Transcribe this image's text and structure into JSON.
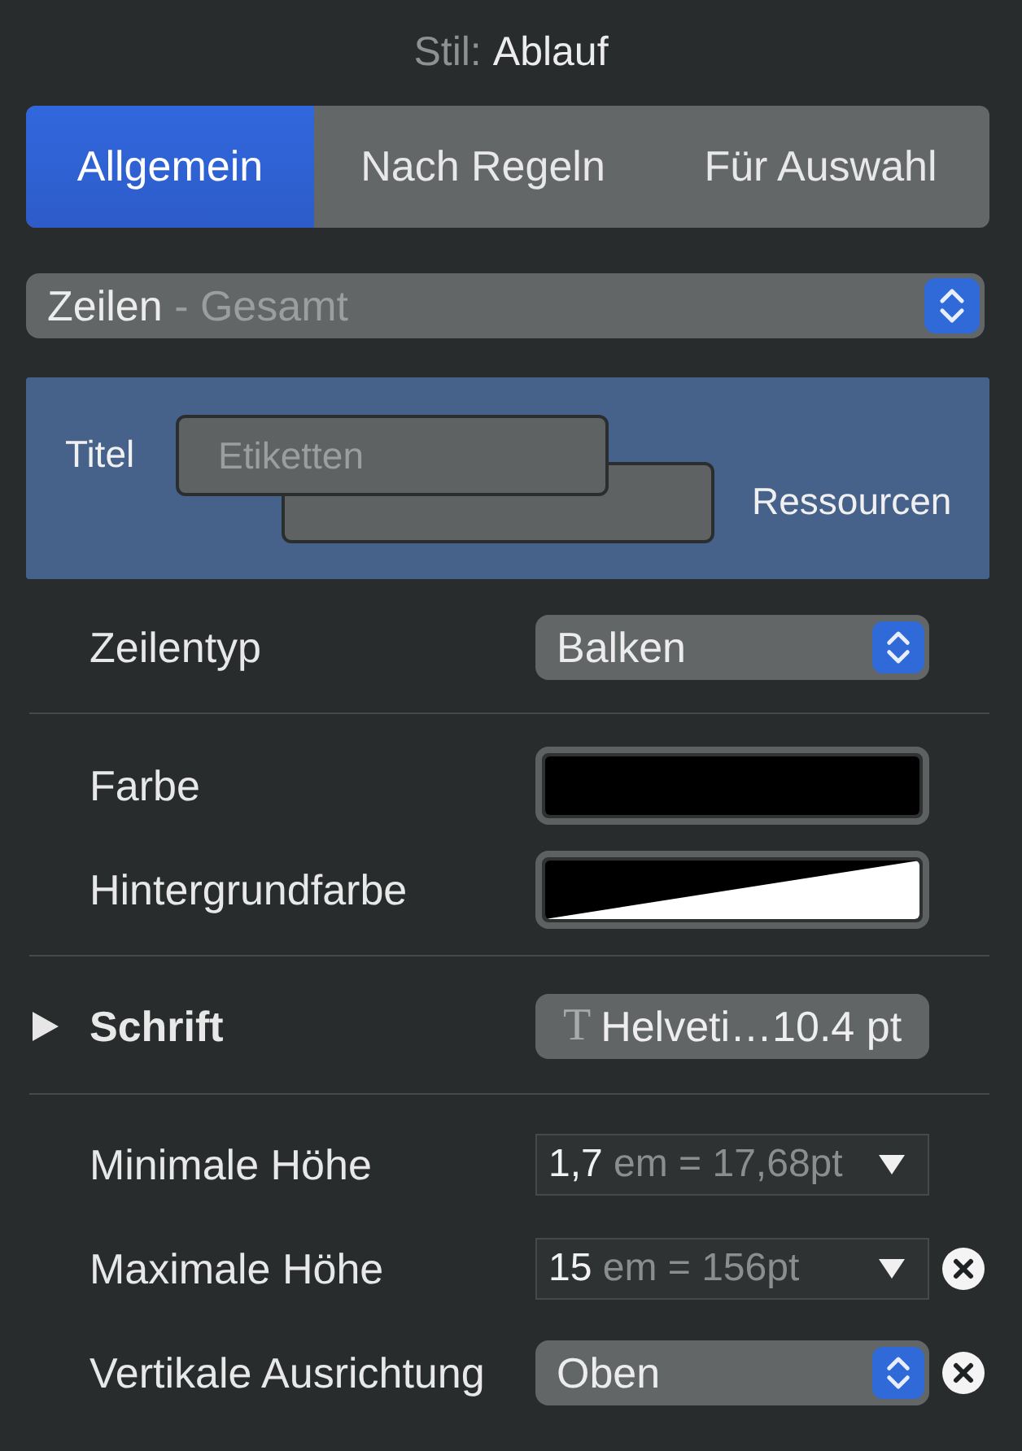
{
  "title": {
    "label": "Stil:",
    "value": "Ablauf"
  },
  "tabs": [
    {
      "label": "Allgemein",
      "selected": true
    },
    {
      "label": "Nach Regeln",
      "selected": false
    },
    {
      "label": "Für Auswahl",
      "selected": false
    }
  ],
  "scope_popup": {
    "value": "Zeilen",
    "detail": "- Gesamt"
  },
  "preview": {
    "title_label": "Titel",
    "bar_label": "Etiketten",
    "resource_label": "Ressourcen"
  },
  "sections": [
    {
      "rows": [
        {
          "kind": "popup",
          "label": "Zeilentyp",
          "value": "Balken",
          "clearable": false
        }
      ]
    },
    {
      "rows": [
        {
          "kind": "color",
          "label": "Farbe",
          "color": "#000000",
          "translucent": false
        },
        {
          "kind": "color",
          "label": "Hintergrundfarbe",
          "color": "#000000",
          "translucent": true
        }
      ]
    },
    {
      "rows": [
        {
          "kind": "font",
          "label": "Schrift",
          "expanded": false,
          "icon_glyph": "T",
          "value": "Helveti…10.4 pt"
        }
      ]
    },
    {
      "rows": [
        {
          "kind": "combo",
          "label": "Minimale Höhe",
          "value": "1,7",
          "detail": "em = 17,68pt",
          "clearable": false
        },
        {
          "kind": "combo",
          "label": "Maximale Höhe",
          "value": "15",
          "detail": "em = 156pt",
          "clearable": true
        },
        {
          "kind": "popup",
          "label": "Vertikale Ausrichtung",
          "value": "Oben",
          "clearable": true
        }
      ]
    }
  ]
}
